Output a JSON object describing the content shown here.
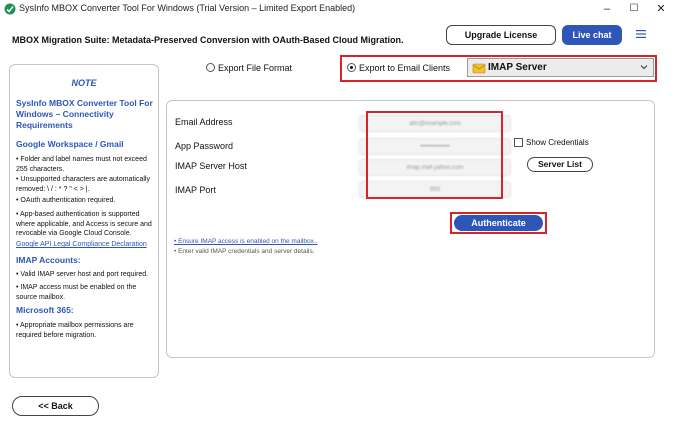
{
  "window": {
    "title": "SysInfo MBOX Converter Tool For Windows (Trial Version – Limited Export Enabled)",
    "controls": {
      "minimize": "–",
      "maximize": "☐",
      "close": "✕"
    }
  },
  "header": {
    "title": "MBOX Migration Suite: Metadata-Preserved Conversion with OAuth-Based Cloud Migration.",
    "upgrade_label": "Upgrade License",
    "livechat_label": "Live chat",
    "menu_icon": "hamburger-icon"
  },
  "sidebar": {
    "note_title": "NOTE",
    "heading": "SysInfo MBOX Converter Tool For Windows – Connectivity Requirements",
    "sections": [
      {
        "title": "Google Workspace / Gmail",
        "bullets": [
          "• Folder and label names must not exceed 255 characters.",
          "• Unsupported characters are automatically removed: \\ / : * ? \" < > |.",
          "• OAuth authentication required.",
          "• App-based authentication is supported where applicable, and Access is secure and revocable via Google Cloud Console."
        ],
        "link": "Google API Legal Compliance Declaration"
      },
      {
        "title": "IMAP Accounts:",
        "bullets": [
          "• Valid IMAP server host and port required.",
          "• IMAP access must be enabled on the source mailbox."
        ]
      },
      {
        "title": "Microsoft 365:",
        "bullets": [
          "• Appropriate mailbox permissions are required before migration."
        ]
      }
    ]
  },
  "export_options": {
    "file_format_label": "Export File Format",
    "email_clients_label": "Export to Email Clients",
    "selected": "email_clients",
    "server_select_value": "IMAP Server"
  },
  "form": {
    "email_label": "Email Address",
    "email_value": "abc@example.com",
    "password_label": "App Password",
    "password_value": "••••••••••••••",
    "host_label": "IMAP Server Host",
    "host_value": "imap.mail.yahoo.com",
    "port_label": "IMAP Port",
    "port_value": "993",
    "show_credentials_label": "Show Credentials",
    "server_list_label": "Server List",
    "authenticate_label": "Authenticate",
    "hint_link": "• Ensure IMAP access is enabled on the mailbox..",
    "hint_text": "• Enter valid IMAP credentials and server details."
  },
  "footer": {
    "back_label": "<<  Back"
  },
  "colors": {
    "accent": "#2e56b8",
    "highlight": "#d8232a"
  }
}
